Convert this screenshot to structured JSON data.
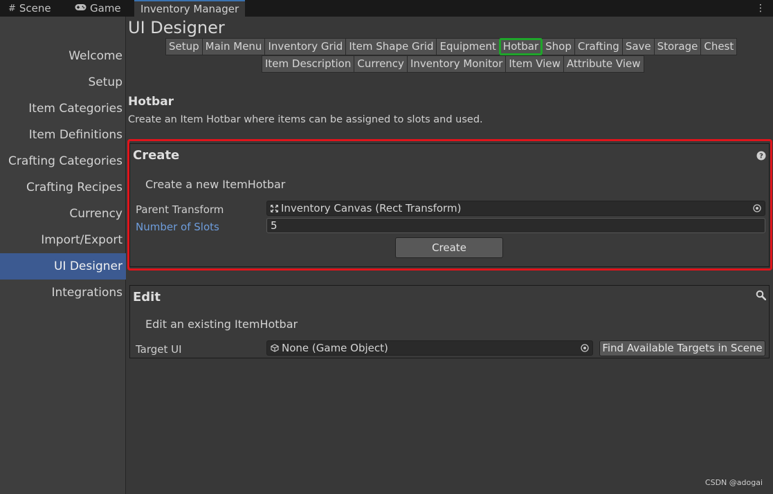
{
  "tabs": {
    "scene": "Scene",
    "game": "Game",
    "inventory_manager": "Inventory Manager",
    "scene_icon": "grid-icon",
    "game_icon": "gamepad-icon",
    "more_icon": "kebab-menu-icon"
  },
  "sidebar": {
    "items": [
      {
        "label": "Welcome"
      },
      {
        "label": "Setup"
      },
      {
        "label": "Item Categories"
      },
      {
        "label": "Item Definitions"
      },
      {
        "label": "Crafting Categories"
      },
      {
        "label": "Crafting Recipes"
      },
      {
        "label": "Currency"
      },
      {
        "label": "Import/Export"
      },
      {
        "label": "UI Designer",
        "active": true
      },
      {
        "label": "Integrations"
      }
    ]
  },
  "main": {
    "title": "UI Designer",
    "toolbar_row1": [
      "Setup",
      "Main Menu",
      "Inventory Grid",
      "Item Shape Grid",
      "Equipment",
      "Hotbar",
      "Shop",
      "Crafting",
      "Save",
      "Storage",
      "Chest"
    ],
    "toolbar_row2": [
      "Item Description",
      "Currency",
      "Inventory Monitor",
      "Item View",
      "Attribute View"
    ],
    "selected_tab": "Hotbar",
    "section_heading": "Hotbar",
    "section_description": "Create an Item Hotbar where items can be assigned to slots and used."
  },
  "create_panel": {
    "title": "Create",
    "help_icon": "help-icon",
    "subtitle": "Create a new ItemHotbar",
    "parent_transform_label": "Parent Transform",
    "parent_transform_value": "Inventory Canvas (Rect Transform)",
    "parent_transform_icon": "rect-transform-icon",
    "slots_label": "Number of Slots",
    "slots_value": "5",
    "create_button": "Create"
  },
  "edit_panel": {
    "title": "Edit",
    "search_icon": "search-icon",
    "subtitle": "Edit an existing ItemHotbar",
    "target_label": "Target UI",
    "target_value": "None (Game Object)",
    "target_icon": "game-object-icon",
    "find_button": "Find Available Targets in Scene"
  },
  "watermark": "CSDN @adogai",
  "colors": {
    "highlight_red": "#e0141b",
    "selected_green": "#1fa52b",
    "sidebar_active": "#3c5a91",
    "link_blue": "#6e9ddc"
  }
}
